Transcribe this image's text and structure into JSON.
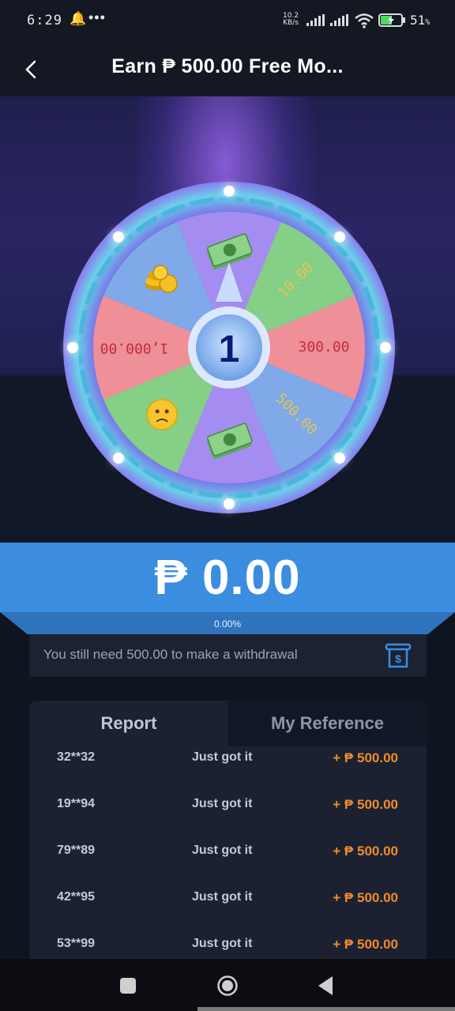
{
  "status_bar": {
    "time": "6:29",
    "net_speed_value": "10.2",
    "net_speed_unit": "KB/s",
    "battery_percent": "51",
    "battery_unit": "%",
    "icons": [
      "bell-icon",
      "more-dots-icon",
      "signal-icon",
      "wifi-icon",
      "battery-charging-icon"
    ]
  },
  "header": {
    "title": "Earn ₱ 500.00 Free Mo...",
    "back_icon": "chevron-left-icon"
  },
  "wheel": {
    "center_label": "1",
    "segments": [
      {
        "type": "icon",
        "icon": "money-icon",
        "color": "#a58cf0"
      },
      {
        "type": "text",
        "label": "10.00",
        "color": "#85cf86"
      },
      {
        "type": "text",
        "label": "300.00",
        "color": "#ef8f98"
      },
      {
        "type": "text",
        "label": "500.00",
        "color": "#7fa9e8"
      },
      {
        "type": "icon",
        "icon": "money-icon",
        "color": "#a58cf0"
      },
      {
        "type": "icon",
        "icon": "sad-face-icon",
        "color": "#85cf86"
      },
      {
        "type": "text",
        "label": "1,000.00",
        "color": "#ef8f98"
      },
      {
        "type": "icon",
        "icon": "coins-icon",
        "color": "#7fa9e8"
      }
    ]
  },
  "balance": {
    "amount": "₱ 0.00",
    "progress": "0.00%",
    "progress_value": 0
  },
  "withdraw": {
    "message": "You still need 500.00 to make a withdrawal",
    "icon": "withdraw-receipt-icon"
  },
  "tabs": {
    "report": "Report",
    "reference": "My Reference",
    "active": "report"
  },
  "report_rows": [
    {
      "user": "32**32",
      "message": "Just got it",
      "amount": "+ ₱ 500.00"
    },
    {
      "user": "19**94",
      "message": "Just got it",
      "amount": "+ ₱ 500.00"
    },
    {
      "user": "79**89",
      "message": "Just got it",
      "amount": "+ ₱ 500.00"
    },
    {
      "user": "42**95",
      "message": "Just got it",
      "amount": "+ ₱ 500.00"
    },
    {
      "user": "53**99",
      "message": "Just got it",
      "amount": "+ ₱ 500.00"
    }
  ],
  "colors": {
    "accent": "#3b8de0",
    "amount": "#f08a2c",
    "background": "#0f1421"
  }
}
